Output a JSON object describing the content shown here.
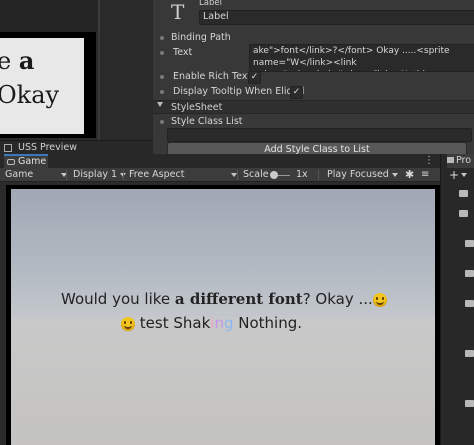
{
  "inspector": {
    "label_header": "Label",
    "label_field": "Label",
    "binding_path_label": "Binding Path",
    "text_label": "Text",
    "text_value": "ake\">font</link>?</font> Okay .....<sprite name=\"W</link><link anim=\"color,shake\">ing</link> Nothing.",
    "enable_rich_text_label": "Enable Rich Text",
    "enable_rich_text_checked": "✓",
    "display_tooltip_label": "Display Tooltip When Elided",
    "display_tooltip_checked": "✓",
    "stylesheet_header": "StyleSheet",
    "style_class_list_label": "Style Class List",
    "add_style_class_button": "Add Style Class to List"
  },
  "left_preview": {
    "line1_pre": "e",
    "line1_bold": "a",
    "line2": "Okay"
  },
  "uss_preview_tab": "USS Preview",
  "game": {
    "tab": "Game",
    "toolbar": {
      "mode": "Game",
      "display": "Display 1",
      "aspect": "Free Aspect",
      "scale_label": "Scale",
      "scale_value": "1x",
      "play_mode": "Play Focused"
    },
    "line1_a": "Would you like ",
    "line1_b": "a different",
    "line1_c": " font",
    "line1_d": "? Okay ...",
    "line2_a": " test ",
    "line2_shak": "Shak",
    "line2_i": "i",
    "line2_n": "n",
    "line2_g": "g",
    "line2_b": " Nothing."
  },
  "project": {
    "tab": "Pro"
  },
  "colors": {
    "accent": "#3a79bb",
    "inspector_bg": "#383838",
    "smiley": "#f2c61c"
  }
}
